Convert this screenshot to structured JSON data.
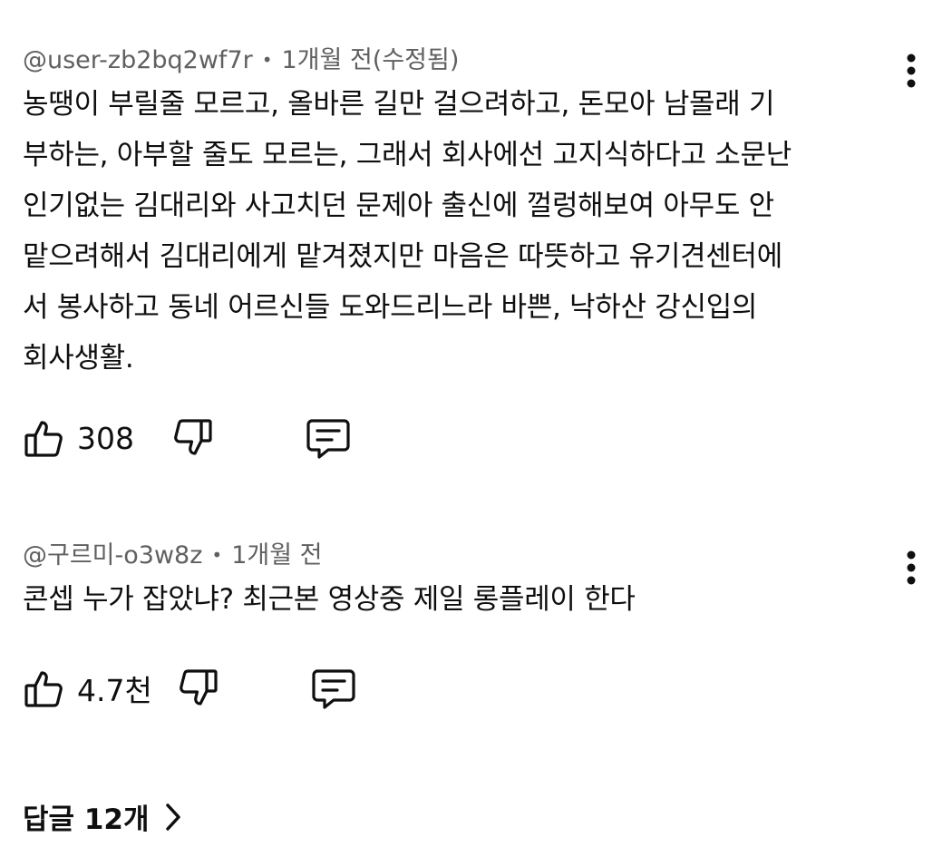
{
  "comments": [
    {
      "author": "@user-zb2bq2wf7r",
      "separator": "•",
      "time": "1개월 전(수정됨)",
      "lines": [
        "농땡이 부릴줄 모르고, 올바른 길만 걸으려하고, 돈모아 남몰래 기",
        "부하는, 아부할 줄도 모르는, 그래서 회사에선 고지식하다고 소문난",
        "인기없는 김대리와 사고치던 문제아 출신에 껄렁해보여 아무도 안",
        "맡으려해서 김대리에게 맡겨졌지만 마음은 따뜻하고 유기견센터에",
        "서 봉사하고 동네 어르신들 도와드리느라 바쁜,  낙하산 강신입의",
        "회사생활."
      ],
      "likes": "308"
    },
    {
      "author": "@구르미-o3w8z",
      "separator": "•",
      "time": "1개월 전",
      "lines": [
        "콘셉 누가 잡았냐? 최근본 영상중 제일 롱플레이 한다"
      ],
      "likes": "4.7천"
    }
  ],
  "replies": {
    "label": "답글 12개"
  },
  "icons": {
    "like": "thumbs-up-icon",
    "dislike": "thumbs-down-icon",
    "reply": "comment-icon",
    "more": "more-vertical-icon",
    "chevron": "chevron-right-icon"
  }
}
